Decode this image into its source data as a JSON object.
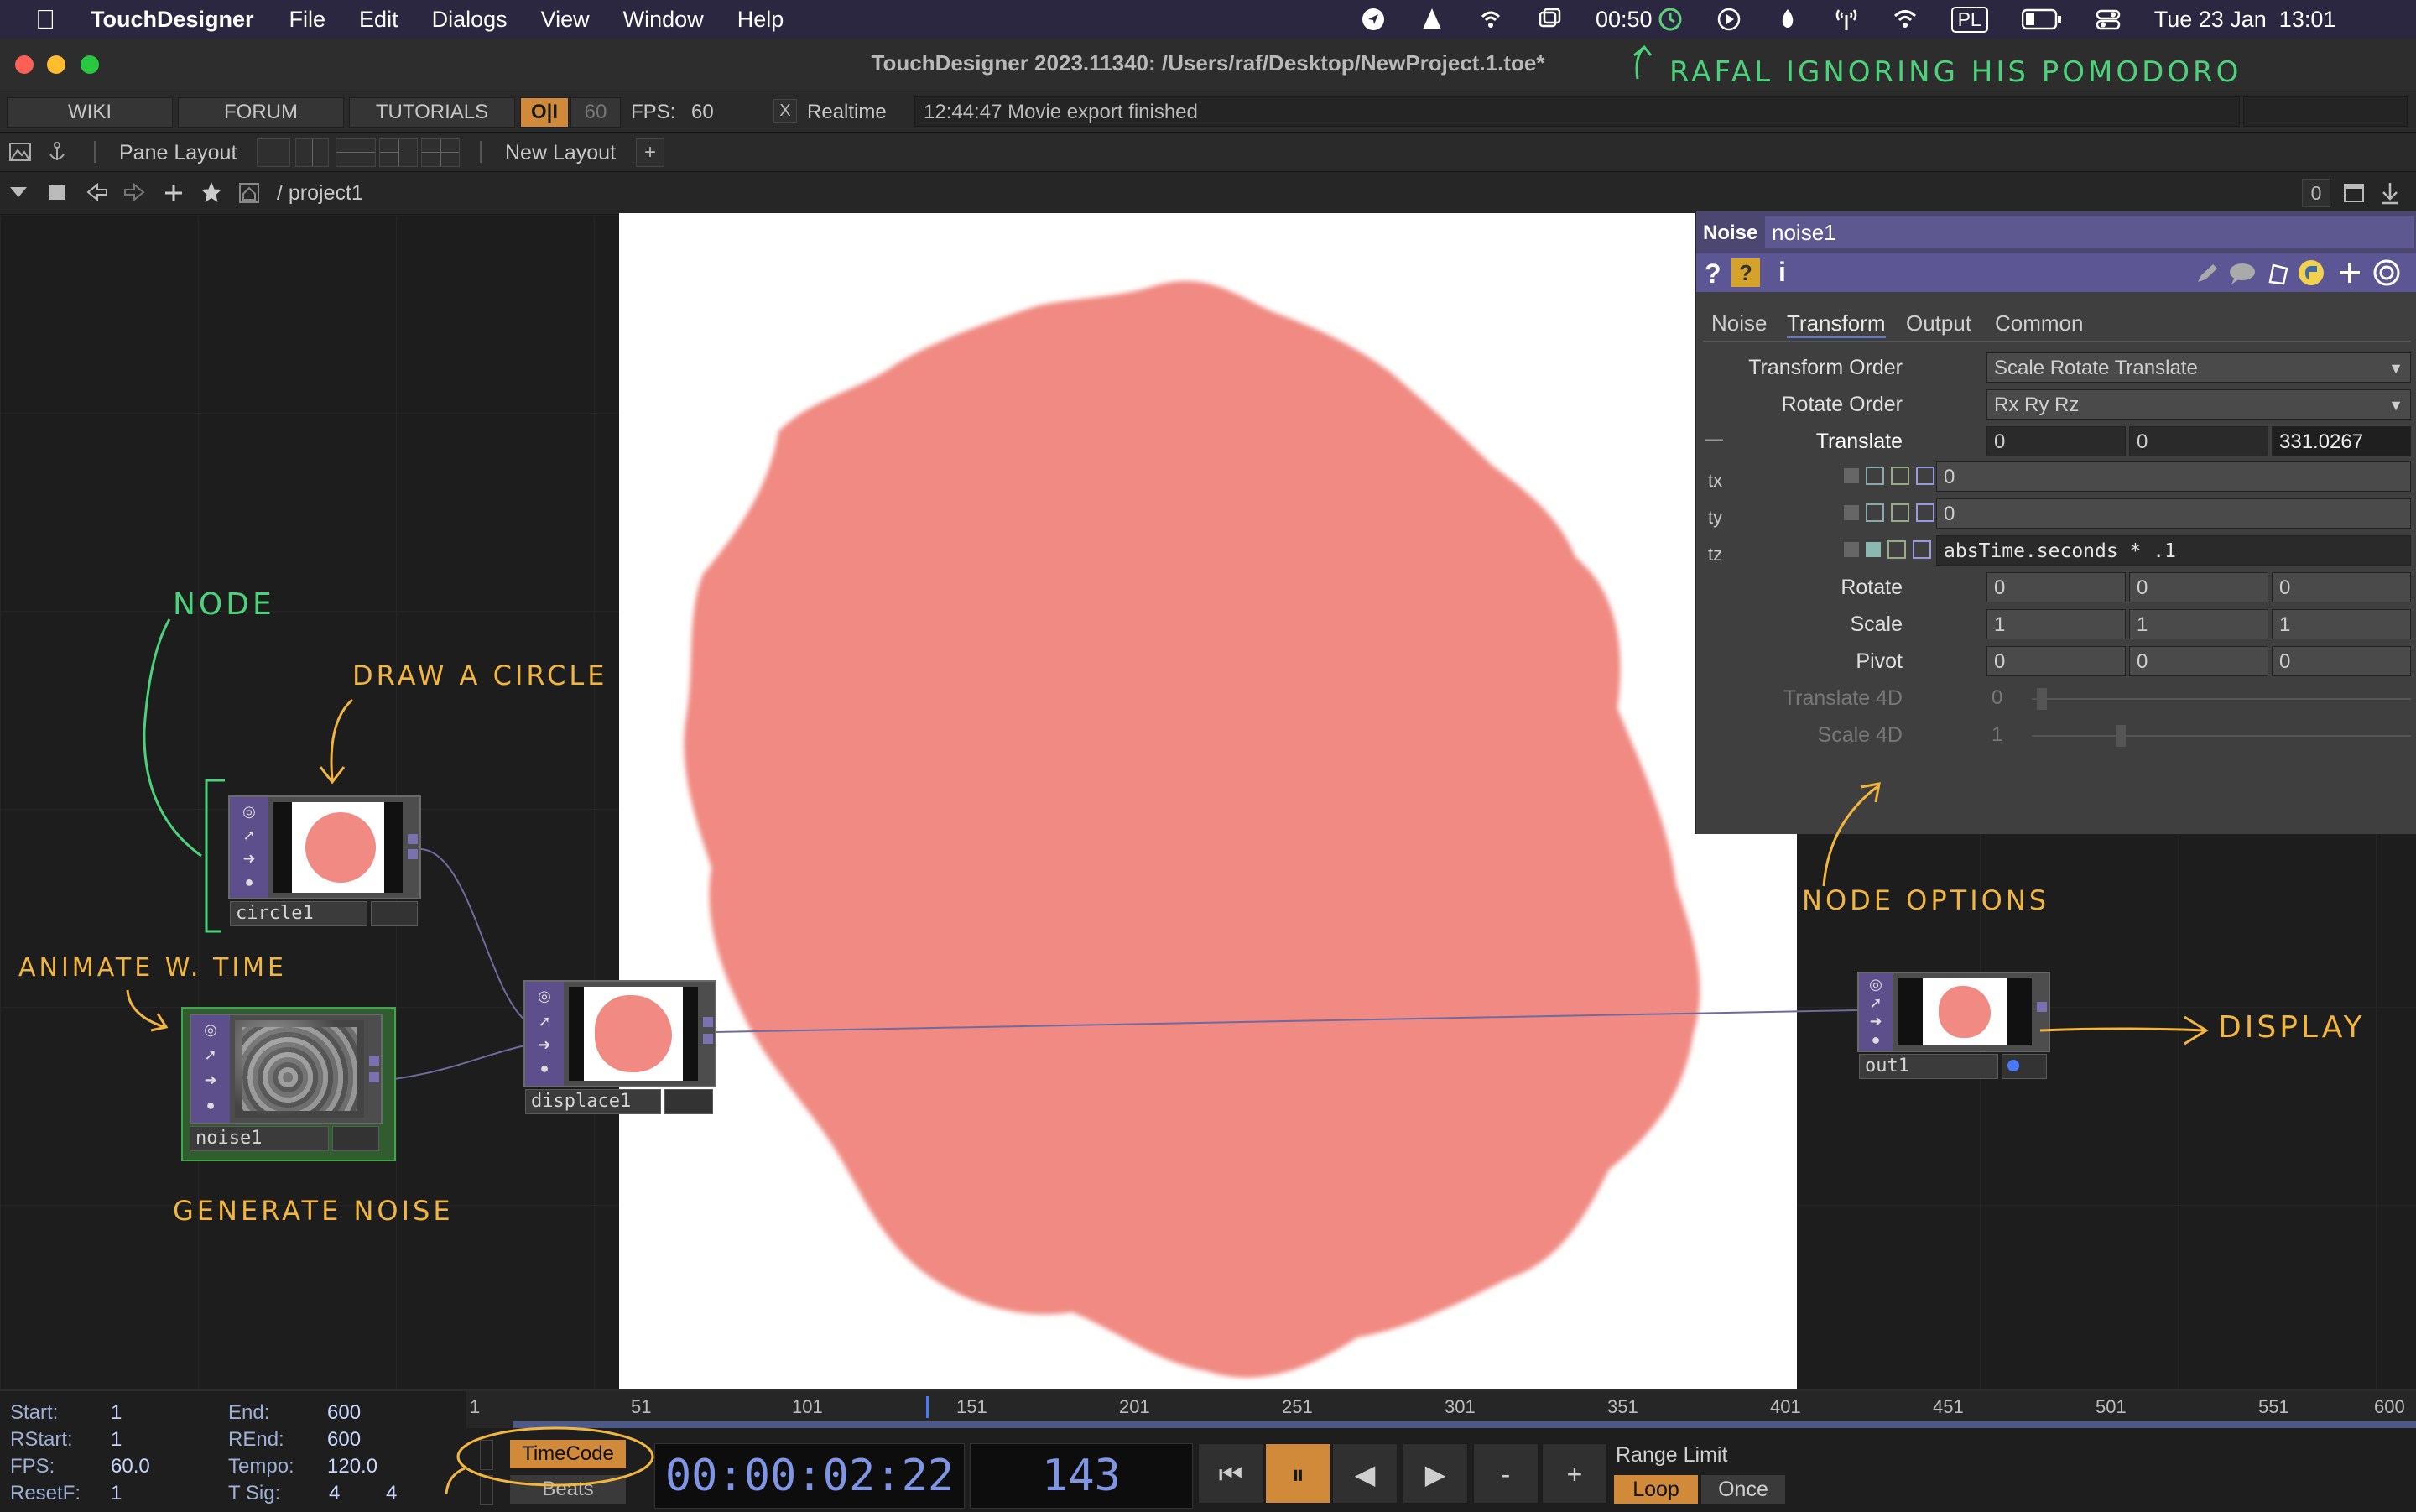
{
  "menubar": {
    "app_name": "TouchDesigner",
    "items": [
      "File",
      "Edit",
      "Dialogs",
      "View",
      "Window",
      "Help"
    ],
    "timer": "00:50",
    "input_lang": "PL",
    "datetime": "Tue 23 Jan  13:01"
  },
  "window": {
    "title": "TouchDesigner 2023.11340: /Users/raf/Desktop/NewProject.1.toe*"
  },
  "toolbar": {
    "wiki": "WIKI",
    "forum": "FORUM",
    "tutorials": "TUTORIALS",
    "oi": "O|I",
    "fps_cap": "60",
    "fps_label": "FPS:",
    "fps_value": "60",
    "realtime_check": "X",
    "realtime_label": "Realtime",
    "message": "12:44:47 Movie export finished"
  },
  "layout_bar": {
    "pane_layout": "Pane Layout",
    "new_layout": "New Layout",
    "add": "+"
  },
  "path_bar": {
    "path": "/ project1",
    "right_value": "0"
  },
  "nodes": {
    "circle": "circle1",
    "noise": "noise1",
    "displace": "displace1",
    "out": "out1"
  },
  "annotations": {
    "top": "RAFAL IGNORING HIS POMODORO",
    "node": "NODE",
    "draw_circle": "DRAW A CIRCLE",
    "animate": "ANIMATE W. TIME",
    "generate_noise": "GENERATE NOISE",
    "node_options": "NODE OPTIONS",
    "display": "DISPLAY"
  },
  "param_panel": {
    "op_type": "Noise",
    "op_name": "noise1",
    "tabs": [
      "Noise",
      "Transform",
      "Output",
      "Common"
    ],
    "active_tab": "Transform",
    "transform_order_label": "Transform Order",
    "transform_order_value": "Scale Rotate Translate",
    "rotate_order_label": "Rotate Order",
    "rotate_order_value": "Rx Ry Rz",
    "translate_label": "Translate",
    "translate": [
      "0",
      "0",
      "331.0267"
    ],
    "tx_label": "tx",
    "tx_value": "0",
    "ty_label": "ty",
    "ty_value": "0",
    "tz_label": "tz",
    "tz_expr": "absTime.seconds * .1",
    "rotate_label": "Rotate",
    "rotate": [
      "0",
      "0",
      "0"
    ],
    "scale_label": "Scale",
    "scale": [
      "1",
      "1",
      "1"
    ],
    "pivot_label": "Pivot",
    "pivot": [
      "0",
      "0",
      "0"
    ],
    "translate4d_label": "Translate 4D",
    "translate4d_value": "0",
    "scale4d_label": "Scale 4D",
    "scale4d_value": "1",
    "dash": "—"
  },
  "timeline": {
    "start_label": "Start:",
    "start": "1",
    "end_label": "End:",
    "end": "600",
    "rstart_label": "RStart:",
    "rstart": "1",
    "rend_label": "REnd:",
    "rend": "600",
    "fps_label": "FPS:",
    "fps": "60.0",
    "tempo_label": "Tempo:",
    "tempo": "120.0",
    "resetf_label": "ResetF:",
    "resetf": "1",
    "tsig_label": "T Sig:",
    "tsig_a": "4",
    "tsig_b": "4",
    "ruler": [
      "1",
      "51",
      "101",
      "151",
      "201",
      "251",
      "301",
      "351",
      "401",
      "451",
      "501",
      "551",
      "600"
    ],
    "timecode_btn": "TimeCode",
    "beats_btn": "Beats",
    "timecode": "00:00:02:22",
    "frame": "143",
    "range_limit": "Range Limit",
    "loop": "Loop",
    "once": "Once",
    "minus": "-",
    "plus": "+"
  },
  "colors": {
    "blob": "#f08a82",
    "node_purple": "#5c4f8c",
    "accent_orange": "#d08a3a",
    "annotation_green": "#4cd27a",
    "annotation_yellow": "#f2b640"
  }
}
